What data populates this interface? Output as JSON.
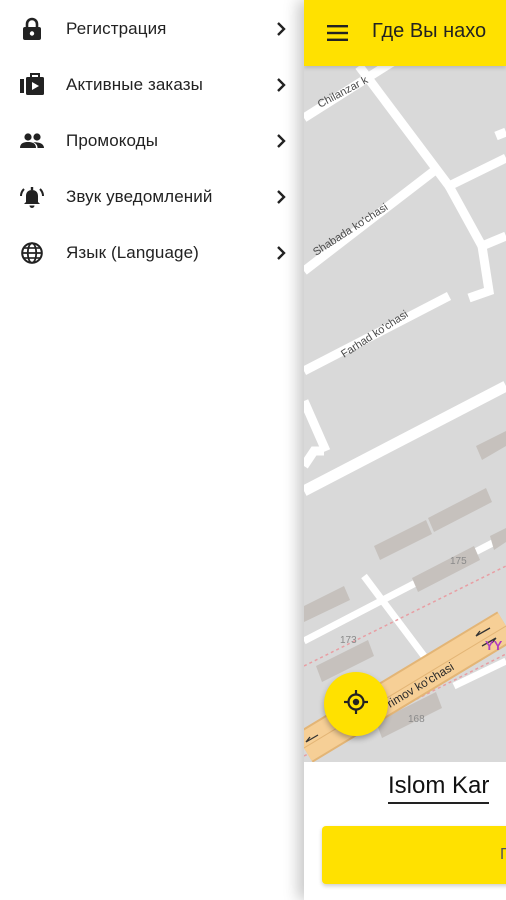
{
  "drawer": {
    "items": [
      {
        "id": "registration",
        "label": "Регистрация",
        "icon": "lock-icon"
      },
      {
        "id": "active-orders",
        "label": "Активные заказы",
        "icon": "orders-icon"
      },
      {
        "id": "promocodes",
        "label": "Промокоды",
        "icon": "people-icon"
      },
      {
        "id": "notification-sound",
        "label": "Звук уведомлений",
        "icon": "bell-icon"
      },
      {
        "id": "language",
        "label": "Язык (Language)",
        "icon": "globe-icon"
      }
    ]
  },
  "appbar": {
    "title": "Где Вы нахо"
  },
  "map": {
    "streets": [
      "Chilanzar k",
      "Shabada ko'chasi",
      "Farhad ko'chasi",
      "rimov ko'chasi"
    ],
    "house_numbers": [
      "175",
      "173",
      "168"
    ],
    "poi_glyph": "ΥΥ"
  },
  "address": {
    "value": "Islom Kar"
  },
  "order_button": {
    "label": "П"
  },
  "colors": {
    "accent": "#ffe100",
    "map_bg": "#d9d9d9",
    "road": "#ffffff",
    "highway": "#f6cf96"
  }
}
